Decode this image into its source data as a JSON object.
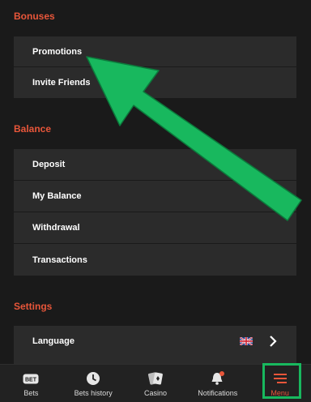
{
  "sections": {
    "bonuses": {
      "title": "Bonuses",
      "items": [
        {
          "label": "Promotions"
        },
        {
          "label": "Invite Friends"
        }
      ]
    },
    "balance": {
      "title": "Balance",
      "items": [
        {
          "label": "Deposit"
        },
        {
          "label": "My Balance"
        },
        {
          "label": "Withdrawal"
        },
        {
          "label": "Transactions"
        }
      ]
    },
    "settings": {
      "title": "Settings",
      "items": [
        {
          "label": "Language",
          "flag_icon": "uk-flag-icon",
          "trailing_icon": "chevron-right-icon"
        }
      ]
    }
  },
  "tabbar": {
    "tabs": [
      {
        "label": "Bets",
        "icon": "bet-icon"
      },
      {
        "label": "Bets history",
        "icon": "clock-icon"
      },
      {
        "label": "Casino",
        "icon": "cards-icon"
      },
      {
        "label": "Notifications",
        "icon": "bell-icon"
      },
      {
        "label": "Menu",
        "icon": "hamburger-icon",
        "active": true
      }
    ]
  },
  "colors": {
    "background": "#1a1a1a",
    "row": "#2b2b2b",
    "accent": "#e8563a",
    "annotation": "#18b85e"
  }
}
